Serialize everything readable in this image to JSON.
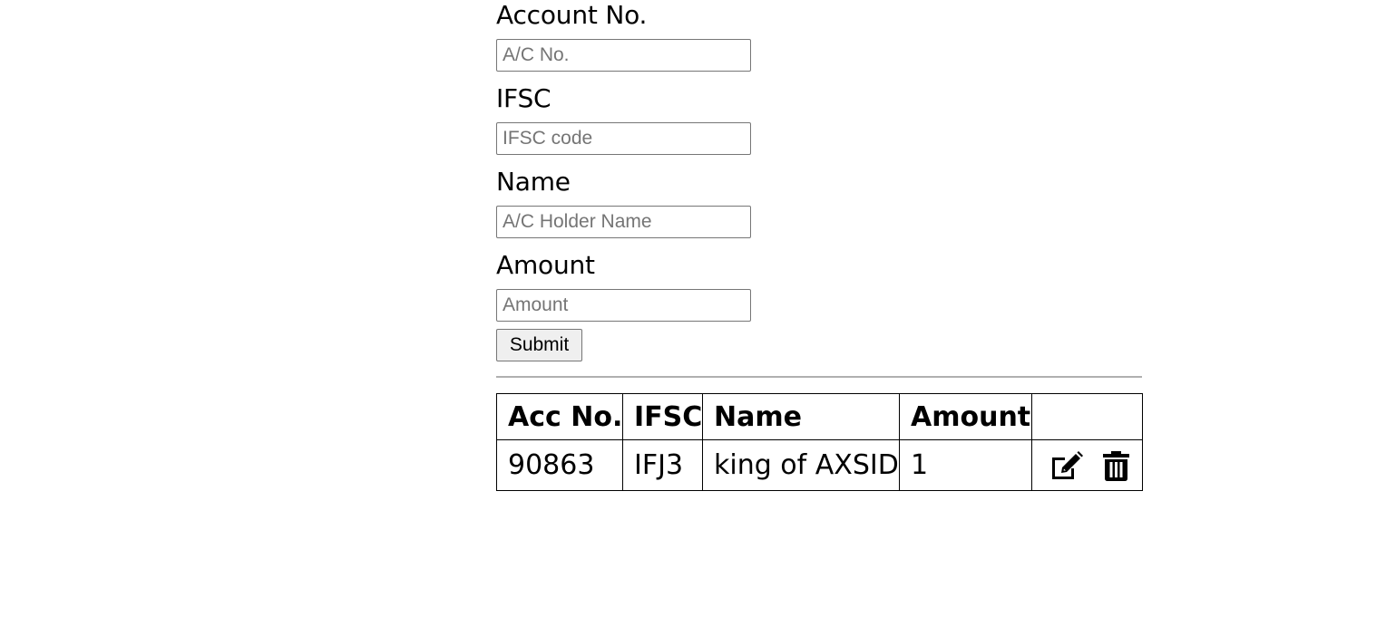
{
  "form": {
    "account_label": "Account No.",
    "account_placeholder": "A/C No.",
    "account_value": "",
    "ifsc_label": "IFSC",
    "ifsc_placeholder": "IFSC code",
    "ifsc_value": "",
    "name_label": "Name",
    "name_placeholder": "A/C Holder Name",
    "name_value": "",
    "amount_label": "Amount",
    "amount_placeholder": "Amount",
    "amount_value": "",
    "submit_label": "Submit"
  },
  "table": {
    "headers": {
      "acc_no": "Acc No.",
      "ifsc": "IFSC",
      "name": "Name",
      "amount": "Amount",
      "actions": ""
    },
    "rows": [
      {
        "acc_no": "90863",
        "ifsc": "IFJ3",
        "name": "king of AXSID",
        "amount": "1",
        "edit_icon": "edit-icon",
        "delete_icon": "trash-icon"
      }
    ]
  }
}
